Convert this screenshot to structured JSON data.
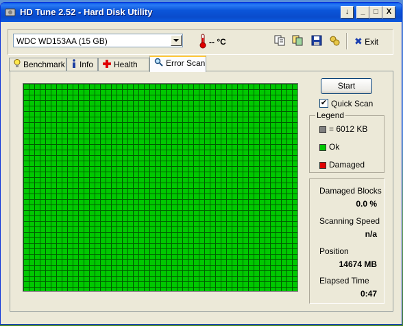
{
  "window": {
    "title": "HD Tune 2.52 - Hard Disk Utility"
  },
  "titlebar_buttons": {
    "help": "↓",
    "minimize": "_",
    "maximize": "□",
    "close": "X"
  },
  "drive": {
    "selected": "WDC WD153AA (15 GB)"
  },
  "temperature": {
    "value": "-- °C"
  },
  "toolbar": {
    "exit_label": "Exit"
  },
  "tabs": [
    {
      "label": "Benchmark",
      "icon": "lightbulb-icon"
    },
    {
      "label": "Info",
      "icon": "info-icon"
    },
    {
      "label": "Health",
      "icon": "health-cross-icon"
    },
    {
      "label": "Error Scan",
      "icon": "magnifier-icon",
      "active": true
    }
  ],
  "scan": {
    "start_label": "Start",
    "quick_scan_label": "Quick Scan",
    "quick_scan_checked": true,
    "grid_color": "#00c800",
    "grid_line_color": "#005a00"
  },
  "legend": {
    "title": "Legend",
    "items": [
      {
        "label": "= 6012 KB",
        "color": "#808080"
      },
      {
        "label": "Ok",
        "color": "#00c800"
      },
      {
        "label": "Damaged",
        "color": "#e00000"
      }
    ]
  },
  "stats": {
    "damaged_blocks_label": "Damaged Blocks",
    "damaged_blocks_value": "0.0 %",
    "scanning_speed_label": "Scanning Speed",
    "scanning_speed_value": "n/a",
    "position_label": "Position",
    "position_value": "14674 MB",
    "elapsed_label": "Elapsed Time",
    "elapsed_value": "0:47"
  }
}
